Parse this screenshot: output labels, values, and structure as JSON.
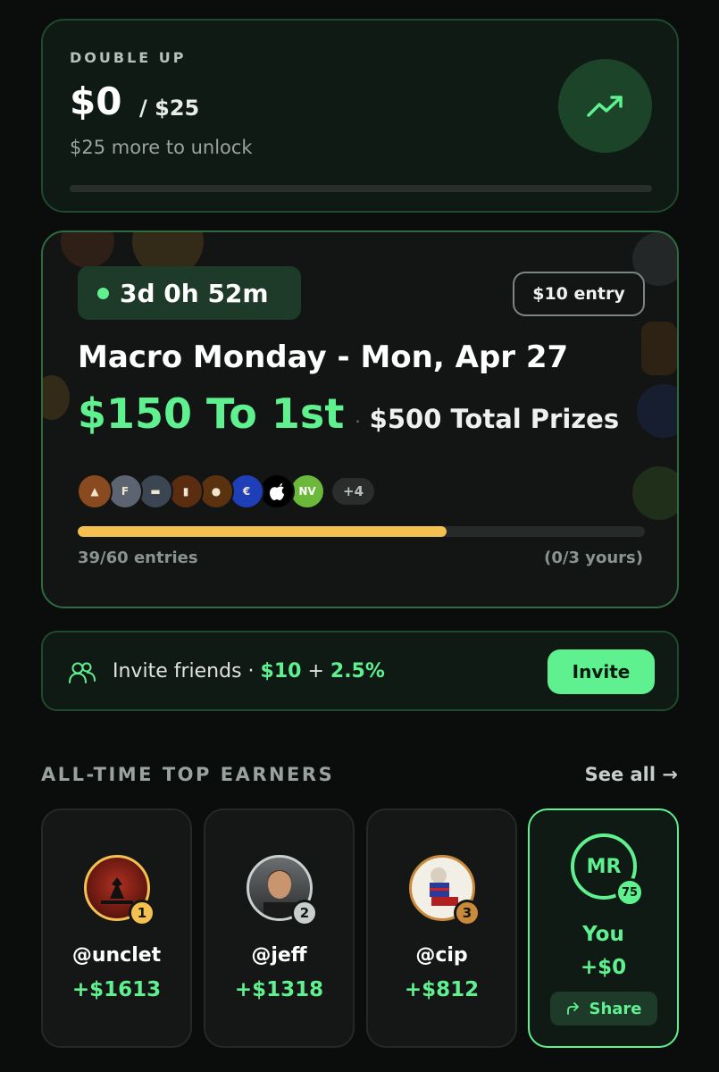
{
  "double_up": {
    "label": "DOUBLE UP",
    "current": "$0",
    "target": "/ $25",
    "subtitle": "$25 more to unlock",
    "progress_fraction": 0.0,
    "icon": "trending-up-icon"
  },
  "contest": {
    "timer": "3d 0h 52m",
    "entry_fee": "$10 entry",
    "title": "Macro Monday - Mon, Apr 27",
    "first_prize": "$150 To 1st",
    "separator": "·",
    "total_prizes": "$500 Total Prizes",
    "assets": [
      {
        "icon": "bell-icon",
        "color": "#8a4a1f",
        "glyph": "▲"
      },
      {
        "icon": "coin-f-icon",
        "color": "#5b6470",
        "glyph": "F"
      },
      {
        "icon": "bag-icon",
        "color": "#3c4652",
        "glyph": "▬"
      },
      {
        "icon": "barrel-icon",
        "color": "#5a2c10",
        "glyph": "▮"
      },
      {
        "icon": "oil-drop-icon",
        "color": "#5a3210",
        "glyph": "●"
      },
      {
        "icon": "euro-plug-icon",
        "color": "#1e3fb8",
        "glyph": "€"
      },
      {
        "icon": "apple-icon",
        "color": "#000000",
        "glyph": ""
      },
      {
        "icon": "nvidia-icon",
        "color": "#6bb83a",
        "glyph": "NV"
      }
    ],
    "more_assets": "+4",
    "entries_text": "39/60 entries",
    "yours_text": "(0/3 yours)",
    "entries_fraction": 0.65,
    "accent_color": "#f4c04f"
  },
  "invite": {
    "label": "Invite friends ·",
    "bonus_amount": "$10",
    "bonus_plus": "+",
    "bonus_percent": "2.5%",
    "button": "Invite"
  },
  "top_earners": {
    "title": "ALL-TIME TOP EARNERS",
    "see_all": "See all →",
    "earners": [
      {
        "rank": "1",
        "handle": "@unclet",
        "amount": "+$1613",
        "badge_color": "#f4c04f"
      },
      {
        "rank": "2",
        "handle": "@jeff",
        "amount": "+$1318",
        "badge_color": "#c9cfcc"
      },
      {
        "rank": "3",
        "handle": "@cip",
        "amount": "+$812",
        "badge_color": "#c98a3a"
      }
    ],
    "you": {
      "initials": "MR",
      "level": "75",
      "label": "You",
      "amount": "+$0",
      "share": "Share"
    }
  },
  "colors": {
    "accent_green": "#5ff08f",
    "background": "#0b0c0c"
  }
}
